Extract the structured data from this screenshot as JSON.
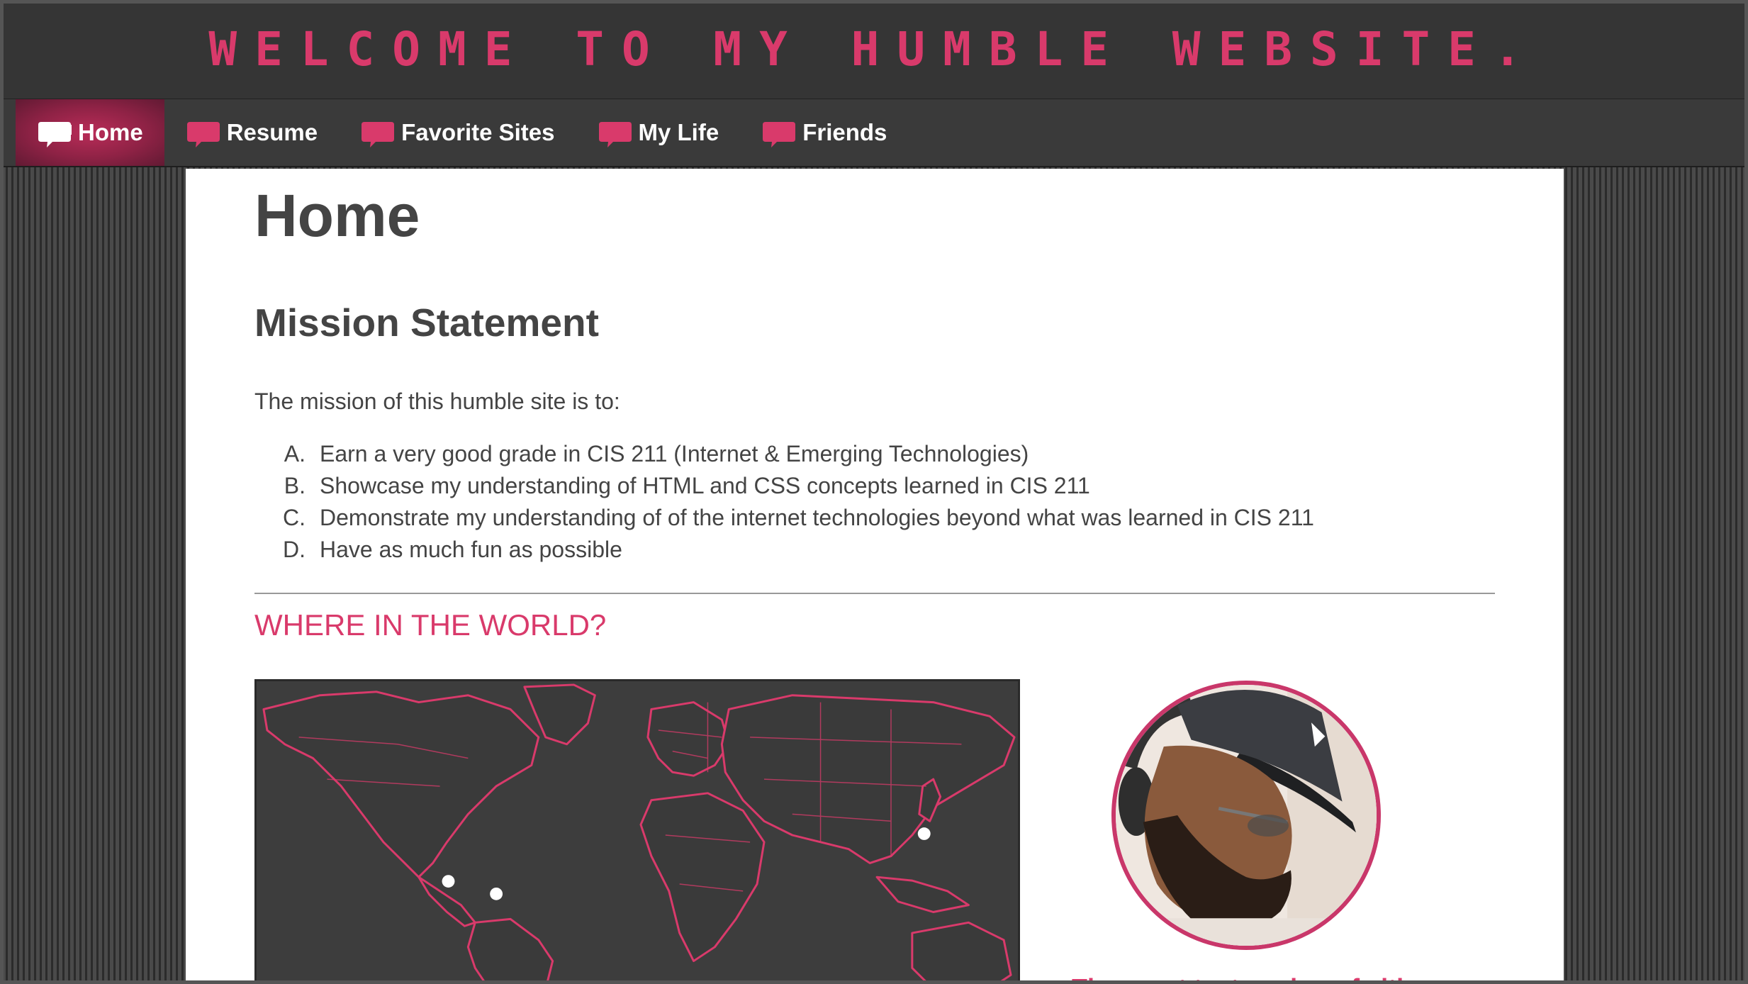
{
  "header": {
    "title": "WELCOME TO MY HUMBLE WEBSITE."
  },
  "nav": {
    "items": [
      {
        "label": "Home",
        "active": true
      },
      {
        "label": "Resume",
        "active": false
      },
      {
        "label": "Favorite Sites",
        "active": false
      },
      {
        "label": "My Life",
        "active": false
      },
      {
        "label": "Friends",
        "active": false
      }
    ]
  },
  "main": {
    "page_title": "Home",
    "mission": {
      "heading": "Mission Statement",
      "intro": "The mission of this humble site is to:",
      "goals": [
        {
          "letter": "A.",
          "text": "Earn a very good grade in CIS 211 (Internet & Emerging Technologies)"
        },
        {
          "letter": "B.",
          "text": "Showcase my understanding of HTML and CSS concepts learned in CIS 211"
        },
        {
          "letter": "C.",
          "text": "Demonstrate my understanding of of the internet technologies beyond what was learned in CIS 211"
        },
        {
          "letter": "D.",
          "text": "Have as much fun as possible"
        }
      ]
    },
    "world": {
      "heading": "WHERE IN THE WORLD?",
      "caption": "The great tastemaker of cities"
    }
  },
  "colors": {
    "accent": "#d93a6b",
    "header_bg": "#353535",
    "nav_bg": "#3a3a3a",
    "content_bg": "#ffffff",
    "text": "#444444",
    "map_bg": "#3d3d3d"
  }
}
